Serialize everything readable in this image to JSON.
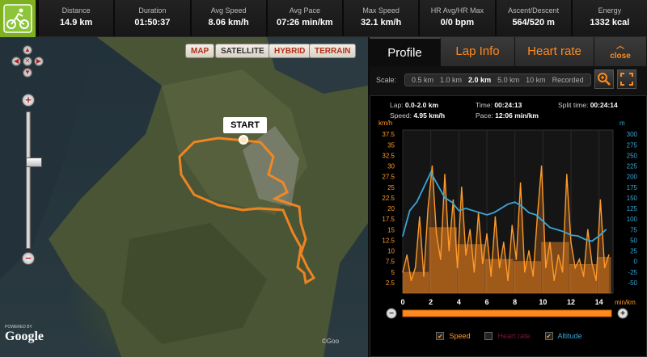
{
  "stats": [
    {
      "label": "Distance",
      "value": "14.9 km"
    },
    {
      "label": "Duration",
      "value": "01:50:37"
    },
    {
      "label": "Avg Speed",
      "value": "8.06 km/h"
    },
    {
      "label": "Avg Pace",
      "value": "07:26 min/km"
    },
    {
      "label": "Max Speed",
      "value": "32.1 km/h"
    },
    {
      "label": "HR Avg/HR Max",
      "value": "0/0 bpm"
    },
    {
      "label": "Ascent/Descent",
      "value": "564/520 m"
    },
    {
      "label": "Energy",
      "value": "1332 kcal"
    }
  ],
  "sport_icon": "cycling-icon",
  "map": {
    "types": [
      "MAP",
      "SATELLITE",
      "HYBRID",
      "TERRAIN"
    ],
    "start_label": "START",
    "powered_by": "POWERED BY",
    "google": "Google",
    "copyright": "©Goo"
  },
  "tabs": {
    "profile": "Profile",
    "lap_info": "Lap Info",
    "heart_rate": "Heart rate",
    "close": "close"
  },
  "scale": {
    "label": "Scale:",
    "options": [
      "0.5 km",
      "1.0 km",
      "2.0 km",
      "5.0 km",
      "10 km",
      "Recorded"
    ],
    "selected": "2.0 km"
  },
  "info": {
    "lap_label": "Lap:",
    "lap_value": "0.0-2.0 km",
    "time_label": "Time:",
    "time_value": "00:24:13",
    "split_label": "Split time:",
    "split_value": "00:24:14",
    "speed_label": "Speed:",
    "speed_value": "4.95 km/h",
    "pace_label": "Pace:",
    "pace_value": "12:06 min/km"
  },
  "legend": {
    "speed": "Speed",
    "heart_rate": "Heart rate",
    "altitude": "Altitude"
  },
  "colors": {
    "accent": "#ff8a1e",
    "speed": "#ff9a2a",
    "altitude": "#3aa6d8",
    "sport": "#7fb020"
  },
  "chart_data": {
    "type": "line",
    "left_unit": "km/h",
    "right_unit": "m",
    "x_unit": "min/km",
    "x_ticks": [
      0,
      2,
      4,
      6,
      8,
      10,
      12,
      14
    ],
    "xlim": [
      0,
      15
    ],
    "y_left_ticks": [
      2.5,
      5,
      7.5,
      10,
      12.5,
      15,
      17.5,
      20,
      22.5,
      25,
      27.5,
      30,
      32.5,
      35,
      37.5
    ],
    "ylim_left": [
      0,
      38.5
    ],
    "y_right_ticks": [
      -50,
      -25,
      0,
      25,
      50,
      75,
      100,
      125,
      150,
      175,
      200,
      225,
      250,
      275,
      300
    ],
    "ylim_right": [
      -75,
      310
    ],
    "series": [
      {
        "name": "Speed",
        "x": [
          0,
          0.3,
          0.6,
          0.9,
          1.2,
          1.5,
          1.8,
          2.1,
          2.4,
          2.7,
          3.0,
          3.3,
          3.6,
          3.9,
          4.2,
          4.5,
          4.8,
          5.1,
          5.4,
          5.7,
          6.0,
          6.3,
          6.6,
          6.9,
          7.2,
          7.5,
          7.8,
          8.1,
          8.4,
          8.7,
          9.0,
          9.3,
          9.6,
          9.9,
          10.2,
          10.5,
          10.8,
          11.1,
          11.4,
          11.7,
          12.0,
          12.3,
          12.6,
          12.9,
          13.2,
          13.5,
          13.8,
          14.1,
          14.4,
          14.7
        ],
        "values": [
          5,
          9,
          3,
          6,
          18,
          4,
          20,
          30,
          14,
          8,
          28,
          10,
          22,
          6,
          25,
          9,
          15,
          5,
          19,
          7,
          14,
          4,
          18,
          6,
          12,
          3,
          16,
          8,
          26,
          5,
          10,
          4,
          18,
          30,
          6,
          12,
          3,
          9,
          5,
          28,
          12,
          6,
          8,
          4,
          15,
          7,
          3,
          22,
          6,
          9
        ]
      },
      {
        "name": "Altitude",
        "x": [
          0,
          0.5,
          1,
          1.5,
          2,
          2.5,
          3,
          3.5,
          4,
          4.5,
          5,
          5.5,
          6,
          6.5,
          7,
          7.5,
          8,
          8.5,
          9,
          9.5,
          10,
          10.5,
          11,
          11.5,
          12,
          12.5,
          13,
          13.5,
          14,
          14.5
        ],
        "values": [
          60,
          120,
          140,
          175,
          210,
          180,
          150,
          140,
          120,
          125,
          120,
          115,
          110,
          115,
          125,
          135,
          140,
          130,
          115,
          110,
          95,
          80,
          75,
          70,
          62,
          60,
          52,
          48,
          60,
          75
        ]
      }
    ],
    "bars": {
      "name": "Lap speed",
      "x_start": [
        0,
        1.9,
        3.9,
        5.9,
        7.9,
        9.9,
        11.9,
        13.9
      ],
      "x_end": [
        1.9,
        3.9,
        5.9,
        7.9,
        9.9,
        11.9,
        13.9,
        14.9
      ],
      "values": [
        4.95,
        15.5,
        11.5,
        8,
        7.5,
        12,
        6.8,
        8.5
      ]
    }
  }
}
